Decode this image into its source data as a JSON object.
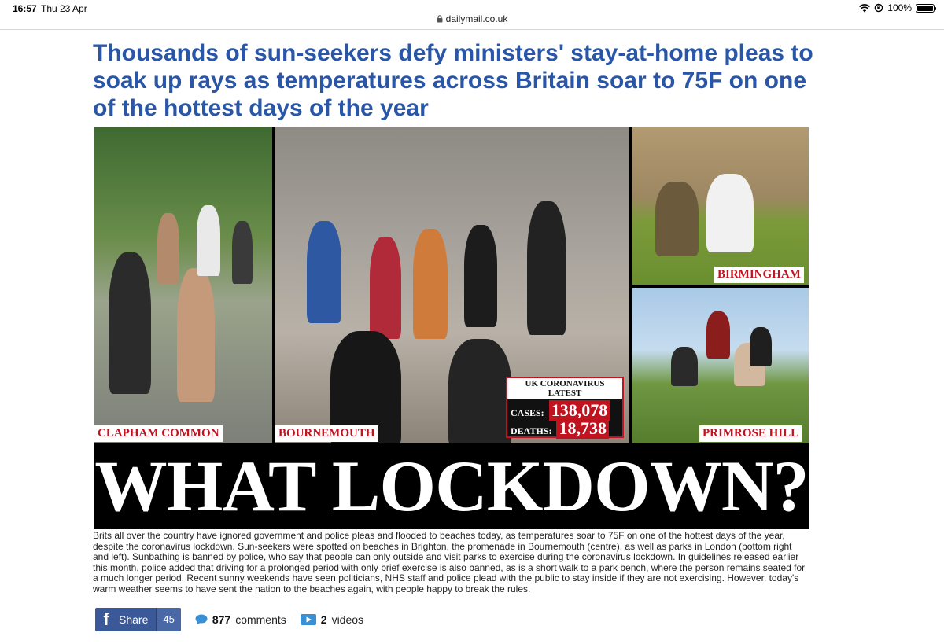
{
  "status_bar": {
    "time": "16:57",
    "date": "Thu 23 Apr",
    "battery_percent": "100%",
    "battery_level": 1.0,
    "icons": [
      "wifi-icon",
      "orientation-lock-icon",
      "battery-icon"
    ]
  },
  "browser": {
    "url": "dailymail.co.uk",
    "icons": [
      "lock-icon"
    ]
  },
  "article": {
    "headline": "Thousands of sun-seekers defy ministers' stay-at-home pleas to soak up rays as temperatures across Britain soar to 75F on one of the hottest days of the year",
    "image": {
      "labels": {
        "left": "CLAPHAM COMMON",
        "center": "BOURNEMOUTH",
        "top_right": "BIRMINGHAM",
        "bottom_right": "PRIMROSE HILL"
      },
      "covid_box": {
        "title_line1": "UK CORONAVIRUS",
        "title_line2": "LATEST",
        "cases_label": "CASES:",
        "cases_value": "138,078",
        "deaths_label": "DEATHS:",
        "deaths_value": "18,738"
      },
      "banner_text": "WHAT LOCKDOWN?"
    },
    "caption": "Brits all over the country have ignored government and police pleas and flooded to beaches today, as temperatures soar to 75F on one of the hottest days of the year, despite the coronavirus lockdown. Sun-seekers were spotted on beaches in Brighton, the promenade in Bournemouth (centre), as well as parks in London (bottom right and left). Sunbathing is banned by police, who say that people can only outside and visit parks to exercise during the coronavirus lockdown. In guidelines released earlier this month, police added that driving for a prolonged period with only brief exercise is also banned, as is a short walk to a park bench, where the person remains seated for a much longer period. Recent sunny weekends have seen politicians, NHS staff and police plead with the public to stay inside if they are not exercising. However, today's warm weather seems to have sent the nation to the beaches again, with people happy to break the rules."
  },
  "share_bar": {
    "share_label": "Share",
    "share_count": "45",
    "comments_count": "877",
    "comments_label": "comments",
    "videos_count": "2",
    "videos_label": "videos",
    "colors": {
      "facebook": "#3b5998"
    },
    "icons": [
      "facebook-icon",
      "comment-bubble-icon",
      "video-play-icon"
    ]
  },
  "colors": {
    "headline": "#2a56a8",
    "label_red": "#c1121f"
  }
}
